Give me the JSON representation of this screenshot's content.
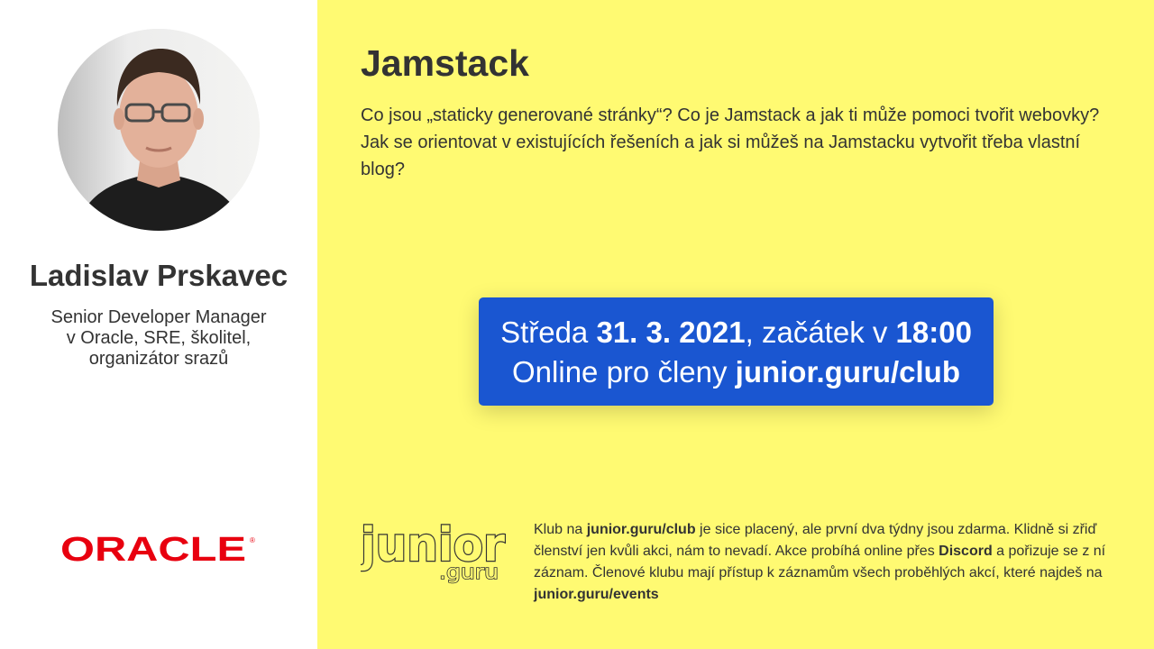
{
  "speaker": {
    "name": "Ladislav Prskavec",
    "bio_lines": [
      "Senior Developer Manager",
      "v Oracle, SRE, školitel,",
      "organizátor srazů"
    ]
  },
  "company": {
    "logo_text": "ORACLE",
    "registered_mark": "®",
    "logo_color": "#e8000f"
  },
  "event": {
    "title": "Jamstack",
    "description": "Co jsou „staticky generované stránky“? Co je Jamstack a jak ti může pomoci tvořit webovky? Jak se orientovat v existujících řešeních a jak si můžeš na Jamstacku vytvořit třeba vlastní blog?",
    "date_prefix": "Středa ",
    "date": "31. 3. 2021",
    "time_prefix": ", začátek v ",
    "time": "18:00",
    "online_prefix": "Online pro členy ",
    "club_url": "junior.guru/club"
  },
  "brand": {
    "logo_word": "junior",
    "logo_suffix": ".guru"
  },
  "club_info": {
    "t1": "Klub na ",
    "b1": "junior.guru/club",
    "t2": " je sice placený, ale první dva týdny jsou zdarma. Klidně si zřiď členství jen kvůli akci, nám to nevadí. Akce probíhá online přes ",
    "b2": "Discord",
    "t3": " a pořizuje se z ní záznam. Členové klubu mají přístup k záznamům všech proběhlých akcí, které najdeš na ",
    "b3": "junior.guru/events"
  },
  "colors": {
    "main_background": "#fffa72",
    "event_box": "#1a56d1",
    "text": "#333333"
  }
}
